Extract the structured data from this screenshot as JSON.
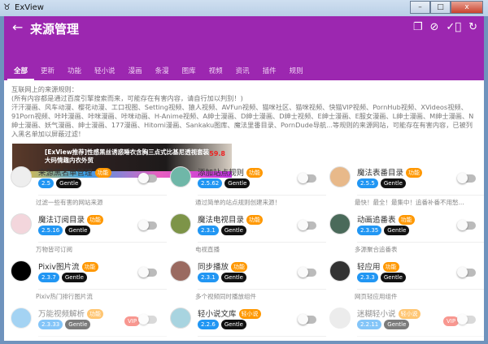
{
  "window": {
    "title": "ExView",
    "minimize": "–",
    "maximize": "□",
    "close": "x"
  },
  "appbar": {
    "back": "←",
    "title": "来源管理",
    "actions": [
      "copy-icon",
      "block-icon",
      "check-circle-icon",
      "refresh-icon"
    ]
  },
  "tabs": [
    "全部",
    "更新",
    "功能",
    "轻小说",
    "漫画",
    "条漫",
    "图库",
    "视频",
    "资讯",
    "插件",
    "规则"
  ],
  "active_tab": "全部",
  "intro": {
    "line1": "互联网上的来源规则：",
    "line2": "(所有内容都是通过百度引擎搜索而来，可能存在有害内容，请自行加以判别！)",
    "line3": "汗汗漫画、风车动漫、樱花动漫、工口视图、Setting视频、猿人视频、AVFun视频、猫咪社区、猫咪视频、快猫VIP视频、PornHub视频、XVideos视频、91Porn视频、咔咔漫画、咔咪漫画、咔咪动画、H-Anime视频、A绅士漫画、D绅士漫画、D绅士视频、E绅士漫画、E服女漫画、L绅士漫画、M绅士漫画、N绅士漫画、妖气漫画、绅士漫画、177漫画、Hitomi漫画、Sankaku图库、魔法里番目录、PornDude导航...等规则的来源网站，可能存在有害内容，已被列入黑名单加以屏蔽过滤！"
  },
  "banner": {
    "text1": "[ExView推荐]性感黑丝诱惑睡衣含胸三点式比基尼透视套装",
    "text2": "大码情趣内衣外贸",
    "price": "59.8"
  },
  "cards": [
    {
      "name": "来源黑名单管理",
      "tag": "功能",
      "version": "2.5",
      "author": "Gentle",
      "desc": "过滤一些有害的网站来源",
      "vip": "",
      "avatar": "#eee",
      "enabled": false,
      "dim": false
    },
    {
      "name": "添加站点规则",
      "tag": "功能",
      "version": "2.5.62",
      "author": "Gentle",
      "desc": "通过简单的站点规则创建来源！",
      "vip": "",
      "avatar": "#6fb7a8",
      "enabled": false,
      "dim": false
    },
    {
      "name": "魔法表番目录",
      "tag": "功能",
      "version": "2.5.5",
      "author": "Gentle",
      "desc": "最快！最全！最集中！追番补番不用愁...",
      "vip": "",
      "avatar": "#e8b98a",
      "enabled": false,
      "dim": false
    },
    {
      "name": "魔法订阅目录",
      "tag": "功能",
      "version": "2.5.16",
      "author": "Gentle",
      "desc": "万物皆可订阅",
      "vip": "",
      "avatar": "#f3d6dc",
      "enabled": false,
      "dim": false
    },
    {
      "name": "魔法电视目录",
      "tag": "功能",
      "version": "2.3.1",
      "author": "Gentle",
      "desc": "电视直播",
      "vip": "",
      "avatar": "#7d9448",
      "enabled": false,
      "dim": false
    },
    {
      "name": "动画追番表",
      "tag": "功能",
      "version": "2.3.35",
      "author": "Gentle",
      "desc": "多源聚合追番表",
      "vip": "",
      "avatar": "#4a6a5a",
      "enabled": false,
      "dim": false
    },
    {
      "name": "Pixiv图片流",
      "tag": "功能",
      "version": "2.3.7",
      "author": "Gentle",
      "desc": "Pixiv热门排行图片流",
      "vip": "",
      "avatar": "#000",
      "enabled": false,
      "dim": false
    },
    {
      "name": "同步播放",
      "tag": "功能",
      "version": "2.3.1",
      "author": "Gentle",
      "desc": "多个视频同时播放组件",
      "vip": "",
      "avatar": "#9a6a60",
      "enabled": false,
      "dim": false
    },
    {
      "name": "轻应用",
      "tag": "功能",
      "version": "2.3.3",
      "author": "Gentle",
      "desc": "网页轻应用组件",
      "vip": "",
      "avatar": "#333",
      "enabled": false,
      "dim": false
    },
    {
      "name": "万能视频解析",
      "tag": "功能",
      "version": "2.3.33",
      "author": "Gentle",
      "desc": "",
      "vip": "VIP",
      "avatar": "#5ab0ea",
      "enabled": false,
      "dim": true
    },
    {
      "name": "轻小说文库",
      "tag": "轻小说",
      "version": "2.2.6",
      "author": "Gentle",
      "desc": "",
      "vip": "",
      "avatar": "#a8d4e0",
      "enabled": false,
      "dim": false
    },
    {
      "name": "迷糊轻小说",
      "tag": "轻小说",
      "version": "2.2.11",
      "author": "Gentle",
      "desc": "",
      "vip": "VIP",
      "avatar": "#ddd",
      "enabled": false,
      "dim": true
    }
  ]
}
